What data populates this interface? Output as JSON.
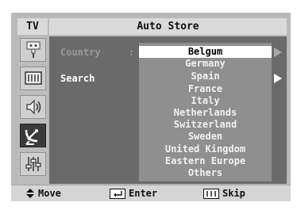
{
  "header": {
    "source_label": "TV",
    "title": "Auto Store"
  },
  "sidebar": {
    "icons": [
      "input-icon",
      "picture-icon",
      "sound-icon",
      "channel-icon",
      "setup-icon"
    ],
    "selected_index": 3
  },
  "menu": {
    "country_label": "Country",
    "colon": ":",
    "search_label": "Search"
  },
  "country_list": {
    "selected": "Belgum",
    "options": [
      "Belgum",
      "Germany",
      "Spain",
      "France",
      "Italy",
      "Netherlands",
      "Switzerland",
      "Sweden",
      "United Kingdom",
      "Eastern Europe",
      "Others"
    ]
  },
  "footer": {
    "move_label": "Move",
    "enter_label": "Enter",
    "skip_label": "Skip"
  },
  "colors": {
    "frame": "#b9b9b9",
    "panel": "#6a6a6a",
    "listbox": "#8f8f8f",
    "highlight": "#ffffff"
  }
}
